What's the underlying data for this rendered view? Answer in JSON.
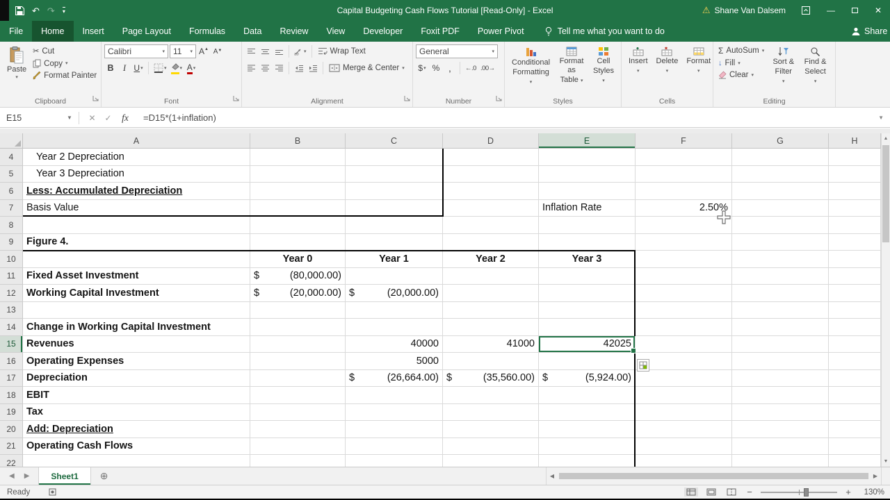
{
  "window": {
    "title": "Capital Budgeting Cash Flows Tutorial  [Read-Only] -  Excel",
    "user": "Shane Van Dalsem"
  },
  "ribbon": {
    "tabs": [
      {
        "label": "File",
        "active": false
      },
      {
        "label": "Home",
        "active": true
      },
      {
        "label": "Insert",
        "active": false
      },
      {
        "label": "Page Layout",
        "active": false
      },
      {
        "label": "Formulas",
        "active": false
      },
      {
        "label": "Data",
        "active": false
      },
      {
        "label": "Review",
        "active": false
      },
      {
        "label": "View",
        "active": false
      },
      {
        "label": "Developer",
        "active": false
      },
      {
        "label": "Foxit PDF",
        "active": false
      },
      {
        "label": "Power Pivot",
        "active": false
      }
    ],
    "tellme": "Tell me what you want to do",
    "share": "Share",
    "font_name": "Calibri",
    "font_size": "11",
    "number_format": "General",
    "groups": {
      "clipboard": {
        "label": "Clipboard",
        "paste": "Paste",
        "cut": "Cut",
        "copy": "Copy",
        "format_painter": "Format Painter"
      },
      "font": {
        "label": "Font"
      },
      "alignment": {
        "label": "Alignment",
        "wrap_text": "Wrap Text",
        "merge_center": "Merge & Center"
      },
      "number": {
        "label": "Number"
      },
      "styles": {
        "label": "Styles",
        "conditional_1": "Conditional",
        "conditional_2": "Formatting",
        "format_table_1": "Format as",
        "format_table_2": "Table",
        "cell_styles_1": "Cell",
        "cell_styles_2": "Styles"
      },
      "cells": {
        "label": "Cells",
        "insert": "Insert",
        "delete": "Delete",
        "format": "Format"
      },
      "editing": {
        "label": "Editing",
        "autosum": "AutoSum",
        "fill": "Fill",
        "clear": "Clear",
        "sort_1": "Sort &",
        "sort_2": "Filter",
        "find_1": "Find &",
        "find_2": "Select"
      }
    }
  },
  "formula_bar": {
    "cell_ref": "E15",
    "formula": "=D15*(1+inflation)",
    "fx": "fx"
  },
  "grid": {
    "columns": [
      "A",
      "B",
      "C",
      "D",
      "E",
      "F",
      "G",
      "H"
    ],
    "selected": {
      "col": "E",
      "row": 15
    },
    "rows": [
      {
        "n": 4,
        "cells": [
          {
            "c": "A",
            "t": "Year 2 Depreciation",
            "ind": 1
          }
        ]
      },
      {
        "n": 5,
        "cells": [
          {
            "c": "A",
            "t": "Year 3 Depreciation",
            "ind": 1
          }
        ]
      },
      {
        "n": 6,
        "cells": [
          {
            "c": "A",
            "t": "Less: Accumulated Depreciation",
            "b": 1,
            "u": 1
          }
        ]
      },
      {
        "n": 7,
        "cells": [
          {
            "c": "A",
            "t": "Basis Value"
          },
          {
            "c": "E",
            "t": "Inflation Rate"
          },
          {
            "c": "F",
            "t": "2.50%",
            "align": "right"
          }
        ]
      },
      {
        "n": 8,
        "cells": []
      },
      {
        "n": 9,
        "cells": [
          {
            "c": "A",
            "t": "Figure 4.",
            "b": 1
          }
        ]
      },
      {
        "n": 10,
        "cells": [
          {
            "c": "B",
            "t": "Year 0",
            "b": 1,
            "align": "center"
          },
          {
            "c": "C",
            "t": "Year 1",
            "b": 1,
            "align": "center"
          },
          {
            "c": "D",
            "t": "Year 2",
            "b": 1,
            "align": "center"
          },
          {
            "c": "E",
            "t": "Year 3",
            "b": 1,
            "align": "center"
          }
        ]
      },
      {
        "n": 11,
        "cells": [
          {
            "c": "A",
            "t": "Fixed Asset Investment",
            "b": 1
          },
          {
            "c": "B",
            "cur": "(80,000.00)"
          }
        ]
      },
      {
        "n": 12,
        "cells": [
          {
            "c": "A",
            "t": "Working Capital Investment",
            "b": 1
          },
          {
            "c": "B",
            "cur": "(20,000.00)"
          },
          {
            "c": "C",
            "cur": "(20,000.00)"
          }
        ]
      },
      {
        "n": 13,
        "cells": []
      },
      {
        "n": 14,
        "cells": [
          {
            "c": "A",
            "t": "Change in Working Capital Investment",
            "b": 1
          }
        ]
      },
      {
        "n": 15,
        "cells": [
          {
            "c": "A",
            "t": "Revenues",
            "b": 1
          },
          {
            "c": "C",
            "t": "40000",
            "align": "right"
          },
          {
            "c": "D",
            "t": "41000",
            "align": "right"
          },
          {
            "c": "E",
            "t": "42025",
            "align": "right",
            "sel": 1
          }
        ]
      },
      {
        "n": 16,
        "cells": [
          {
            "c": "A",
            "t": "Operating Expenses",
            "b": 1
          },
          {
            "c": "C",
            "t": "5000",
            "align": "right"
          }
        ]
      },
      {
        "n": 17,
        "cells": [
          {
            "c": "A",
            "t": "Depreciation",
            "b": 1
          },
          {
            "c": "C",
            "cur": "(26,664.00)"
          },
          {
            "c": "D",
            "cur": "(35,560.00)"
          },
          {
            "c": "E",
            "cur": "(5,924.00)"
          }
        ]
      },
      {
        "n": 18,
        "cells": [
          {
            "c": "A",
            "t": "EBIT",
            "b": 1
          }
        ]
      },
      {
        "n": 19,
        "cells": [
          {
            "c": "A",
            "t": "Tax",
            "b": 1
          }
        ]
      },
      {
        "n": 20,
        "cells": [
          {
            "c": "A",
            "t": "Add: Depreciation",
            "b": 1,
            "u": 1
          }
        ]
      },
      {
        "n": 21,
        "cells": [
          {
            "c": "A",
            "t": "Operating Cash Flows",
            "b": 1
          }
        ]
      },
      {
        "n": 22,
        "cells": []
      }
    ]
  },
  "sheets": [
    "Sheet1"
  ],
  "status_bar": {
    "ready": "Ready",
    "zoom": "130%"
  }
}
